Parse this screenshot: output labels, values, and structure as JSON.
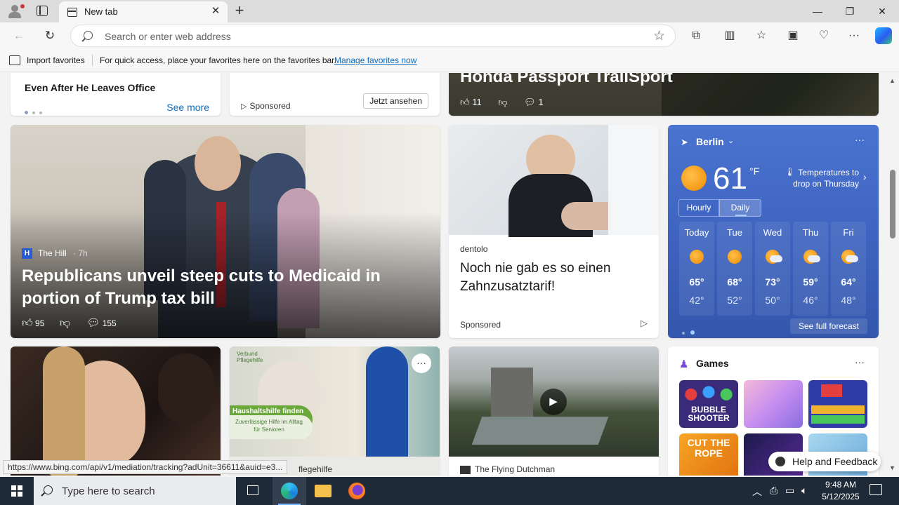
{
  "browser": {
    "tab_title": "New tab",
    "address_placeholder": "Search or enter web address"
  },
  "favorites_bar": {
    "import_label": "Import favorites",
    "hint_text": "For quick access, place your favorites here on the favorites bar.",
    "manage_link": "Manage favorites now"
  },
  "feed": {
    "top_left_card": {
      "headline_tail": "Even After He Leaves Office",
      "see_more": "See more"
    },
    "top_sponsored_card": {
      "sponsored_label": "Sponsored",
      "cta": "Jetzt ansehen"
    },
    "top_right_card": {
      "headline": "Honda Passport TrailSport",
      "likes": "11",
      "comments": "1"
    },
    "hero": {
      "source": "The Hill",
      "age": "· 7h",
      "headline": "Republicans unveil steep cuts to Medicaid in portion of Trump tax bill",
      "likes": "95",
      "comments": "155"
    },
    "ad_dentolo": {
      "advertiser": "dentolo",
      "headline": "Noch nie gab es so einen Zahnzusatztarif!",
      "sponsored_label": "Sponsored"
    },
    "weather": {
      "location": "Berlin",
      "temperature": "61",
      "unit": "°F",
      "alert": "Temperatures to drop on Thursday",
      "tab_hourly": "Hourly",
      "tab_daily": "Daily",
      "days": [
        {
          "name": "Today",
          "high": "65°",
          "low": "42°",
          "icon": "sunny-icon"
        },
        {
          "name": "Tue",
          "high": "68°",
          "low": "52°",
          "icon": "sunny-icon"
        },
        {
          "name": "Wed",
          "high": "73°",
          "low": "50°",
          "icon": "partly-cloudy-icon"
        },
        {
          "name": "Thu",
          "high": "59°",
          "low": "46°",
          "icon": "partly-cloudy-icon"
        },
        {
          "name": "Fri",
          "high": "64°",
          "low": "48°",
          "icon": "partly-cloudy-icon"
        }
      ],
      "see_full_forecast": "See full forecast"
    },
    "ad_pflegehilfe": {
      "banner_title": "Haushaltshilfe finden",
      "banner_sub": "Zuverlässige Hilfe im Alltag für Senioren",
      "logo_text": "Verbund Pflegehilfe",
      "source_tail": "flegehilfe"
    },
    "video_card": {
      "source": "The Flying Dutchman"
    },
    "games": {
      "title": "Games",
      "tiles": [
        {
          "name": "bubble-shooter",
          "label": "BUBBLE SHOOTER"
        },
        {
          "name": "makeup-brushes",
          "label": ""
        },
        {
          "name": "block-puzzle",
          "label": ""
        },
        {
          "name": "cut-the-rope",
          "label": "CUT THE ROPE"
        },
        {
          "name": "game-5",
          "label": ""
        },
        {
          "name": "game-6",
          "label": ""
        }
      ]
    }
  },
  "status_url": "https://www.bing.com/api/v1/mediation/tracking?adUnit=36611&auid=e3...",
  "help_feedback": "Help and Feedback",
  "taskbar": {
    "search_placeholder": "Type here to search",
    "time": "9:48 AM",
    "date": "5/12/2025"
  },
  "colors": {
    "accent": "#0f6cbd",
    "weather_bg": "#3f65c5",
    "taskbar_bg": "#1f2a38"
  }
}
